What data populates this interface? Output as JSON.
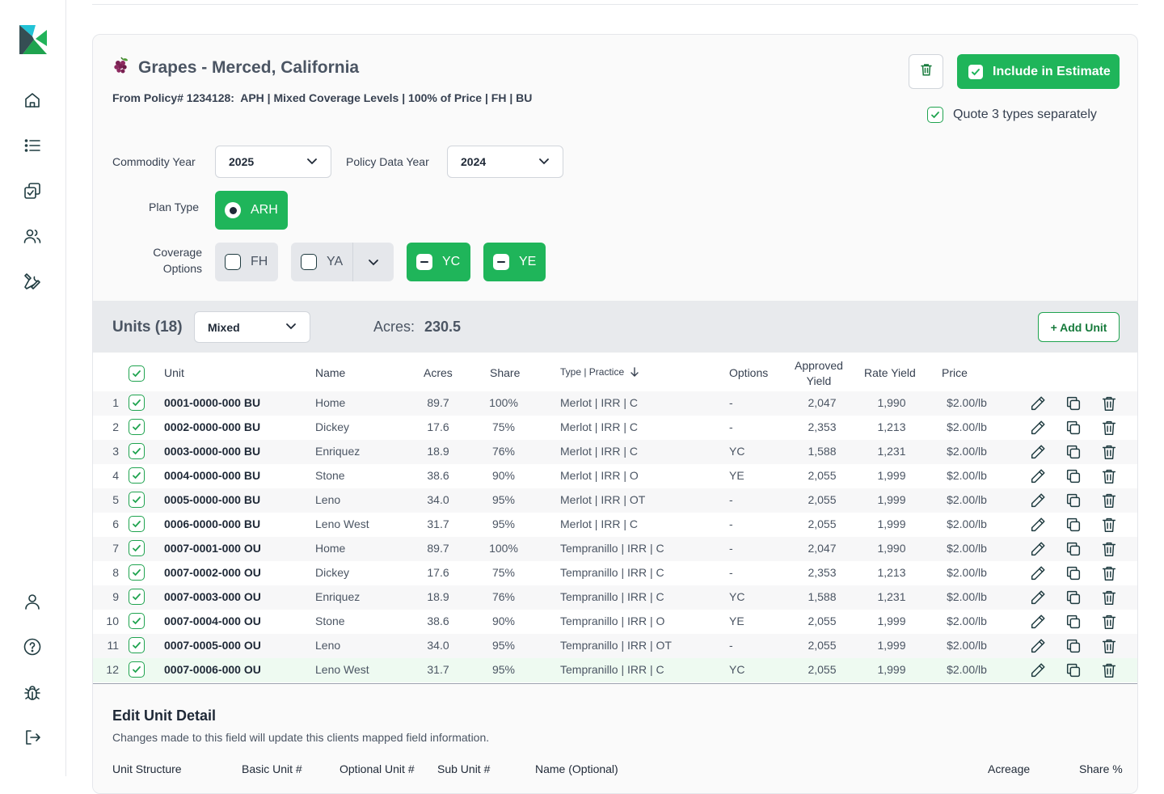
{
  "sidebar": {
    "nav": [
      {
        "name": "home-icon"
      },
      {
        "name": "list-icon"
      },
      {
        "name": "tasks-icon"
      },
      {
        "name": "users-icon"
      },
      {
        "name": "tools-icon"
      }
    ],
    "bottom": [
      {
        "name": "profile-icon"
      },
      {
        "name": "help-icon"
      },
      {
        "name": "bug-icon"
      },
      {
        "name": "logout-icon"
      }
    ]
  },
  "crop": {
    "icon": "grapes-icon",
    "title": "Grapes - Merced, California",
    "policy_line": "From Policy# 1234128:  APH | Mixed Coverage Levels | 100% of Price | FH | BU",
    "include_label": "Include in Estimate",
    "quote_label": "Quote 3 types separately"
  },
  "form": {
    "commodity_year_label": "Commodity Year",
    "commodity_year": "2025",
    "policy_data_year_label": "Policy Data Year",
    "policy_data_year": "2024",
    "plan_type_label": "Plan Type",
    "plan_type": "ARH",
    "coverage_label_1": "Coverage",
    "coverage_label_2": "Options",
    "coverage_options": [
      {
        "label": "FH",
        "state": "unchecked"
      },
      {
        "label": "YA",
        "state": "unchecked"
      },
      {
        "label": "YC",
        "state": "partial"
      },
      {
        "label": "YE",
        "state": "partial"
      }
    ]
  },
  "units": {
    "title": "Units (18)",
    "structure": "Mixed",
    "acres_label": "Acres:",
    "acres_total": "230.5",
    "add_label": "+ Add Unit"
  },
  "table": {
    "headers": {
      "unit": "Unit",
      "name": "Name",
      "acres": "Acres",
      "share": "Share",
      "type": "Type | Practice",
      "options": "Options",
      "approved_1": "Approved",
      "approved_2": "Yield",
      "rate": "Rate Yield",
      "price": "Price"
    },
    "rows": [
      {
        "num": "1",
        "unit": "0001-0000-000 BU",
        "name": "Home",
        "acres": "89.7",
        "share": "100%",
        "type": "Merlot | IRR | C",
        "options": "-",
        "approved": "2,047",
        "rate": "1,990",
        "price": "$2.00/lb"
      },
      {
        "num": "2",
        "unit": "0002-0000-000 BU",
        "name": "Dickey",
        "acres": "17.6",
        "share": "75%",
        "type": "Merlot | IRR | C",
        "options": "-",
        "approved": "2,353",
        "rate": "1,213",
        "price": "$2.00/lb"
      },
      {
        "num": "3",
        "unit": "0003-0000-000 BU",
        "name": "Enriquez",
        "acres": "18.9",
        "share": "76%",
        "type": "Merlot | IRR | C",
        "options": "YC",
        "approved": "1,588",
        "rate": "1,231",
        "price": "$2.00/lb"
      },
      {
        "num": "4",
        "unit": "0004-0000-000 BU",
        "name": "Stone",
        "acres": "38.6",
        "share": "90%",
        "type": "Merlot | IRR | O",
        "options": "YE",
        "approved": "2,055",
        "rate": "1,999",
        "price": "$2.00/lb"
      },
      {
        "num": "5",
        "unit": "0005-0000-000 BU",
        "name": "Leno",
        "acres": "34.0",
        "share": "95%",
        "type": "Merlot | IRR | OT",
        "options": "-",
        "approved": "2,055",
        "rate": "1,999",
        "price": "$2.00/lb"
      },
      {
        "num": "6",
        "unit": "0006-0000-000 BU",
        "name": "Leno West",
        "acres": "31.7",
        "share": "95%",
        "type": "Merlot | IRR | C",
        "options": "-",
        "approved": "2,055",
        "rate": "1,999",
        "price": "$2.00/lb"
      },
      {
        "num": "7",
        "unit": "0007-0001-000 OU",
        "name": "Home",
        "acres": "89.7",
        "share": "100%",
        "type": "Tempranillo | IRR | C",
        "options": "-",
        "approved": "2,047",
        "rate": "1,990",
        "price": "$2.00/lb"
      },
      {
        "num": "8",
        "unit": "0007-0002-000 OU",
        "name": "Dickey",
        "acres": "17.6",
        "share": "75%",
        "type": "Tempranillo | IRR | C",
        "options": "-",
        "approved": "2,353",
        "rate": "1,213",
        "price": "$2.00/lb"
      },
      {
        "num": "9",
        "unit": "0007-0003-000 OU",
        "name": "Enriquez",
        "acres": "18.9",
        "share": "76%",
        "type": "Tempranillo | IRR | C",
        "options": "YC",
        "approved": "1,588",
        "rate": "1,231",
        "price": "$2.00/lb"
      },
      {
        "num": "10",
        "unit": "0007-0004-000 OU",
        "name": "Stone",
        "acres": "38.6",
        "share": "90%",
        "type": "Tempranillo | IRR | O",
        "options": "YE",
        "approved": "2,055",
        "rate": "1,999",
        "price": "$2.00/lb"
      },
      {
        "num": "11",
        "unit": "0007-0005-000 OU",
        "name": "Leno",
        "acres": "34.0",
        "share": "95%",
        "type": "Tempranillo | IRR | OT",
        "options": "-",
        "approved": "2,055",
        "rate": "1,999",
        "price": "$2.00/lb"
      },
      {
        "num": "12",
        "unit": "0007-0006-000 OU",
        "name": "Leno West",
        "acres": "31.7",
        "share": "95%",
        "type": "Tempranillo | IRR | C",
        "options": "YC",
        "approved": "2,055",
        "rate": "1,999",
        "price": "$2.00/lb"
      }
    ]
  },
  "edit": {
    "title": "Edit Unit Detail",
    "subtitle": "Changes made to this field will update this clients mapped field information.",
    "columns": [
      "Unit Structure",
      "Basic Unit #",
      "Optional Unit #",
      "Sub Unit #",
      "Name (Optional)",
      "Acreage",
      "Share %"
    ]
  },
  "colors": {
    "accent": "#1fb55a",
    "accent_dark": "#167a3b",
    "selected_row": "#eefaf1",
    "logo_dark": "#1f3b40",
    "logo_teal": "#22c3d6",
    "logo_green": "#22b35a"
  }
}
